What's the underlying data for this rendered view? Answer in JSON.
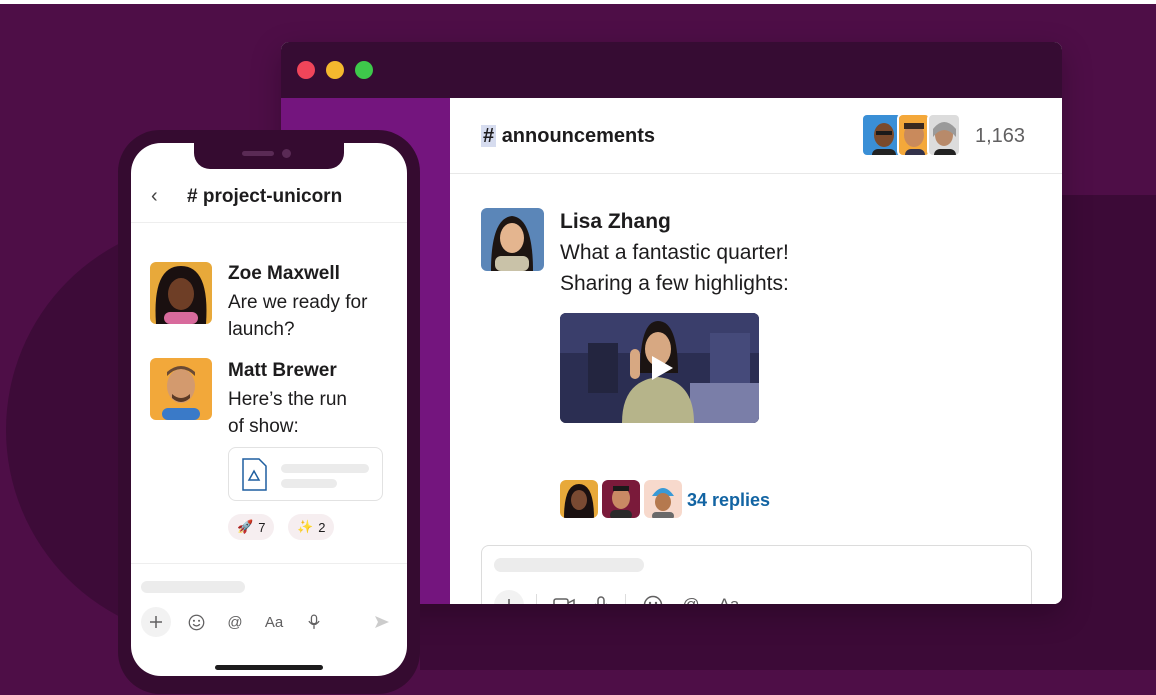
{
  "desktop": {
    "channel_hash": "#",
    "channel_name": "announcements",
    "member_count": "1,163",
    "message": {
      "author": "Lisa Zhang",
      "line1": "What a fantastic quarter!",
      "line2": "Sharing a few highlights:"
    },
    "replies": "34 replies",
    "composer_tools": [
      "plus-icon",
      "video-icon",
      "microphone-icon",
      "emoji-icon",
      "mention-icon",
      "format-icon"
    ],
    "format_label": "Aa",
    "mention_label": "@"
  },
  "phone": {
    "back": "‹",
    "channel": "# project-unicorn",
    "messages": [
      {
        "author": "Zoe Maxwell",
        "text": "Are we ready for launch?"
      },
      {
        "author": "Matt Brewer",
        "text_line1": "Here’s the run",
        "text_line2": "of show:"
      }
    ],
    "zoe_line1": "Are we ready for",
    "zoe_line2": "launch?",
    "reactions": [
      {
        "emoji": "🚀",
        "count": "7"
      },
      {
        "emoji": "✨",
        "count": "2"
      }
    ],
    "format_label": "Aa",
    "mention_label": "@"
  },
  "colors": {
    "brand_purple": "#4a154b",
    "sidebar_purple": "#74157e",
    "link_blue": "#1264a3"
  }
}
